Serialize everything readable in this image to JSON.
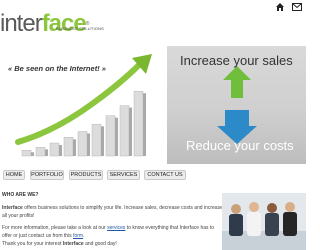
{
  "header": {
    "logo_text_a": "inter",
    "logo_text_b": "face",
    "logo_reg": "®",
    "logo_subtitle": "BUSINESS SOLUTIONS",
    "icons": [
      "home-icon",
      "mail-icon"
    ]
  },
  "banner": {
    "quote": "« Be seen on the Internet! »",
    "increase": "Increase your sales",
    "reduce": "Reduce your costs",
    "chart_data": {
      "type": "bar",
      "categories": [
        "1",
        "2",
        "3",
        "4",
        "5",
        "6",
        "7",
        "8",
        "9"
      ],
      "values": [
        8,
        12,
        18,
        26,
        34,
        44,
        56,
        70,
        90
      ],
      "title": "",
      "xlabel": "",
      "ylabel": "",
      "ylim": [
        0,
        100
      ]
    }
  },
  "nav": {
    "items": [
      "HOME",
      "PORTFOLIO",
      "PRODUCTS",
      "SERVICES",
      "CONTACT US"
    ]
  },
  "content": {
    "heading": "WHO ARE WE?",
    "p1_brand": "Interface",
    "p1_rest": " offers business solutions to simplify your life. Increase sales, decrease costs and increase all your profits!",
    "p2_a": "For more information, please take a look at our ",
    "p2_link": "services",
    "p2_b": " to know everything that Interface has to offer or just contact us from this ",
    "p2_link2": "form",
    "p2_c": ".",
    "p3_a": "Thank you for your interest ",
    "p3_brand": "Interface",
    "p3_b": " and good day!"
  },
  "colors": {
    "accent_green": "#8cc63f",
    "link_blue": "#1f57a8",
    "arrow_blue": "#2d8ac8"
  }
}
